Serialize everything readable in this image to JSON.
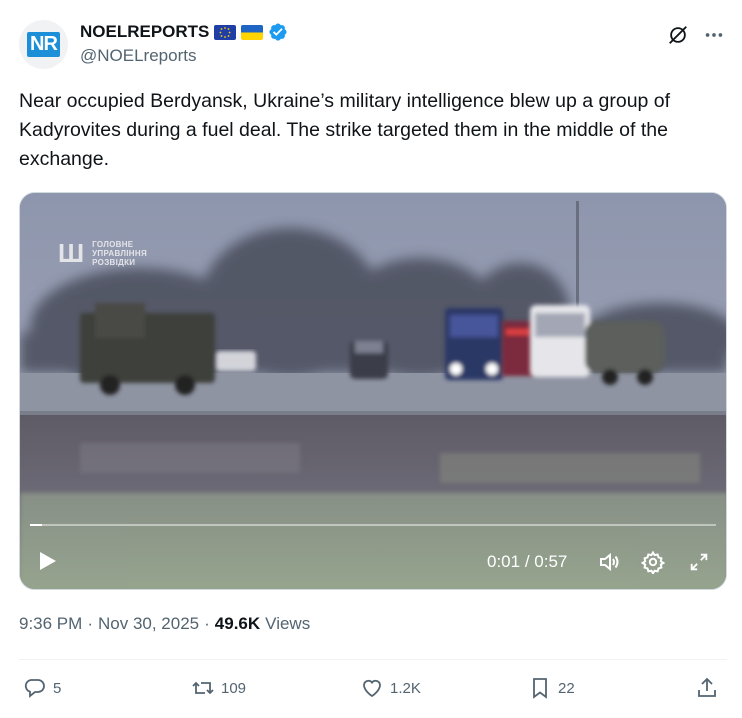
{
  "author": {
    "display_name": "NOELREPORTS",
    "handle": "@NOELreports",
    "avatar_text": "NR",
    "verified": true,
    "flags": [
      "eu-flag-icon",
      "ukraine-flag-icon"
    ]
  },
  "tweet": {
    "text": "Near occupied Berdyansk, Ukraine’s military intelligence blew up a group of Kadyrovites during a fuel deal. The strike targeted them in the middle of the exchange."
  },
  "video": {
    "watermark_lines": [
      "ГОЛОВНЕ",
      "УПРАВЛІННЯ",
      "РОЗВІДКИ"
    ],
    "watermark_symbol": "Ш",
    "current_time": "0:01",
    "separator": " / ",
    "duration": "0:57",
    "progress_fraction": 0.0175
  },
  "meta": {
    "time": "9:36 PM",
    "dot1": "·",
    "date": "Nov 30, 2025",
    "dot2": "·",
    "views_count": "49.6K",
    "views_label": "Views"
  },
  "actions": {
    "replies": "5",
    "reposts": "109",
    "likes": "1.2K",
    "bookmarks": "22"
  },
  "colors": {
    "accent": "#1d9bf0",
    "text": "#0f1419",
    "secondary": "#536471",
    "border": "#cfd9de"
  }
}
